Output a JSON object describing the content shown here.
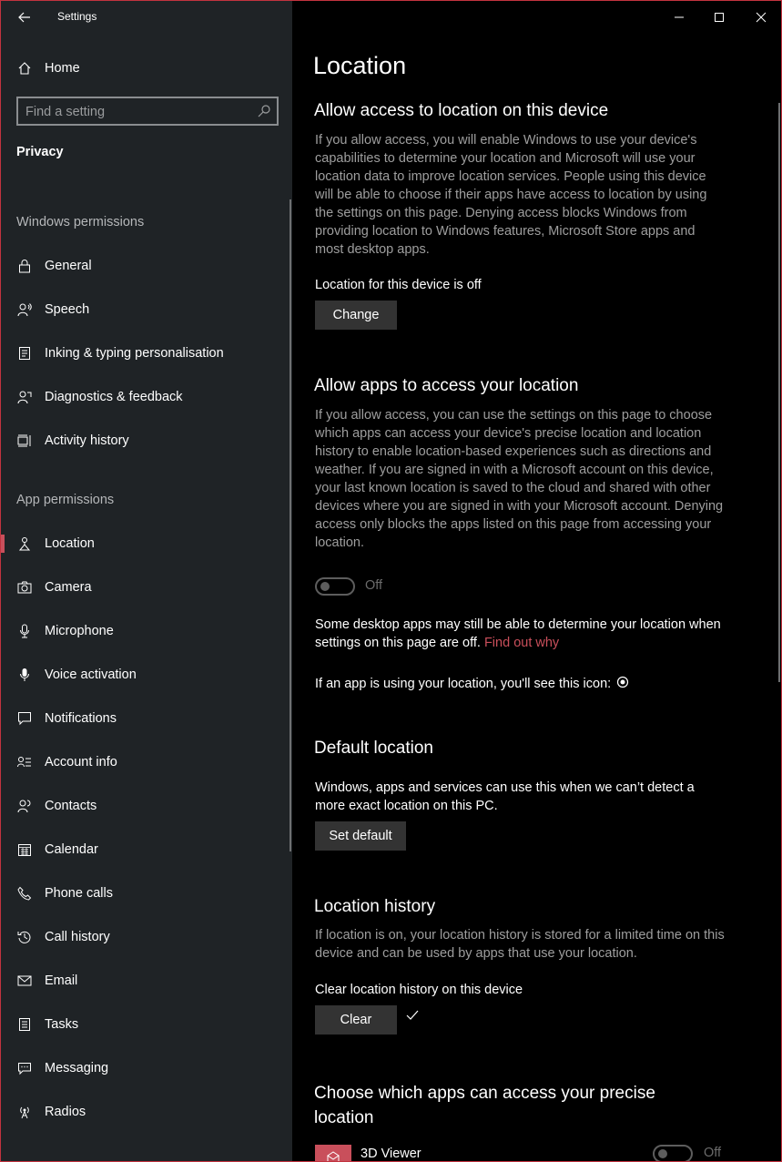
{
  "window": {
    "title": "Settings"
  },
  "sidebar": {
    "home": "Home",
    "search_placeholder": "Find a setting",
    "section": "Privacy",
    "windows_permissions": {
      "heading": "Windows permissions",
      "items": [
        {
          "label": "General",
          "icon": "lock-icon"
        },
        {
          "label": "Speech",
          "icon": "speech-icon"
        },
        {
          "label": "Inking & typing personalisation",
          "icon": "inking-icon"
        },
        {
          "label": "Diagnostics & feedback",
          "icon": "diagnostics-icon"
        },
        {
          "label": "Activity history",
          "icon": "activity-history-icon"
        }
      ]
    },
    "app_permissions": {
      "heading": "App permissions",
      "items": [
        {
          "label": "Location",
          "icon": "location-icon",
          "active": true
        },
        {
          "label": "Camera",
          "icon": "camera-icon"
        },
        {
          "label": "Microphone",
          "icon": "microphone-icon"
        },
        {
          "label": "Voice activation",
          "icon": "voice-activation-icon"
        },
        {
          "label": "Notifications",
          "icon": "notifications-icon"
        },
        {
          "label": "Account info",
          "icon": "account-info-icon"
        },
        {
          "label": "Contacts",
          "icon": "contacts-icon"
        },
        {
          "label": "Calendar",
          "icon": "calendar-icon"
        },
        {
          "label": "Phone calls",
          "icon": "phone-icon"
        },
        {
          "label": "Call history",
          "icon": "call-history-icon"
        },
        {
          "label": "Email",
          "icon": "email-icon"
        },
        {
          "label": "Tasks",
          "icon": "tasks-icon"
        },
        {
          "label": "Messaging",
          "icon": "messaging-icon"
        },
        {
          "label": "Radios",
          "icon": "radios-icon"
        }
      ]
    }
  },
  "main": {
    "title": "Location",
    "device_access": {
      "heading": "Allow access to location on this device",
      "description": "If you allow access, you will enable Windows to use your device's capabilities to determine your location and Microsoft will use your location data to improve location services. People using this device will be able to choose if their apps have access to location by using the settings on this page. Denying access blocks Windows from providing location to Windows features, Microsoft Store apps and most desktop apps.",
      "status": "Location for this device is off",
      "button": "Change"
    },
    "apps_access": {
      "heading": "Allow apps to access your location",
      "description": "If you allow access, you can use the settings on this page to choose which apps can access your device's precise location and location history to enable location-based experiences such as directions and weather. If you are signed in with a Microsoft account on this device, your last known location is saved to the cloud and shared with other devices where you are signed in with your Microsoft account. Denying access only blocks the apps listed on this page from accessing your location.",
      "toggle_state": "Off",
      "desktop_note": "Some desktop apps may still be able to determine your location when settings on this page are off.",
      "find_out_why": "Find out why",
      "icon_note": "If an app is using your location, you'll see this icon:"
    },
    "default_location": {
      "heading": "Default location",
      "description": "Windows, apps and services can use this when we can’t detect a more exact location on this PC.",
      "button": "Set default"
    },
    "history": {
      "heading": "Location history",
      "description": "If location is on, your location history is stored for a limited time on this device and can be used by apps that use your location.",
      "clear_label": "Clear location history on this device",
      "button": "Clear"
    },
    "choose_apps": {
      "heading_line1": "Choose which apps can access your precise",
      "heading_line2": "location",
      "apps": [
        {
          "name": "3D Viewer",
          "state": "Off"
        }
      ]
    }
  },
  "colors": {
    "accent": "#c94f5b",
    "sidebar_bg": "#1f2326",
    "content_bg": "#000000",
    "button_bg": "#333333"
  }
}
